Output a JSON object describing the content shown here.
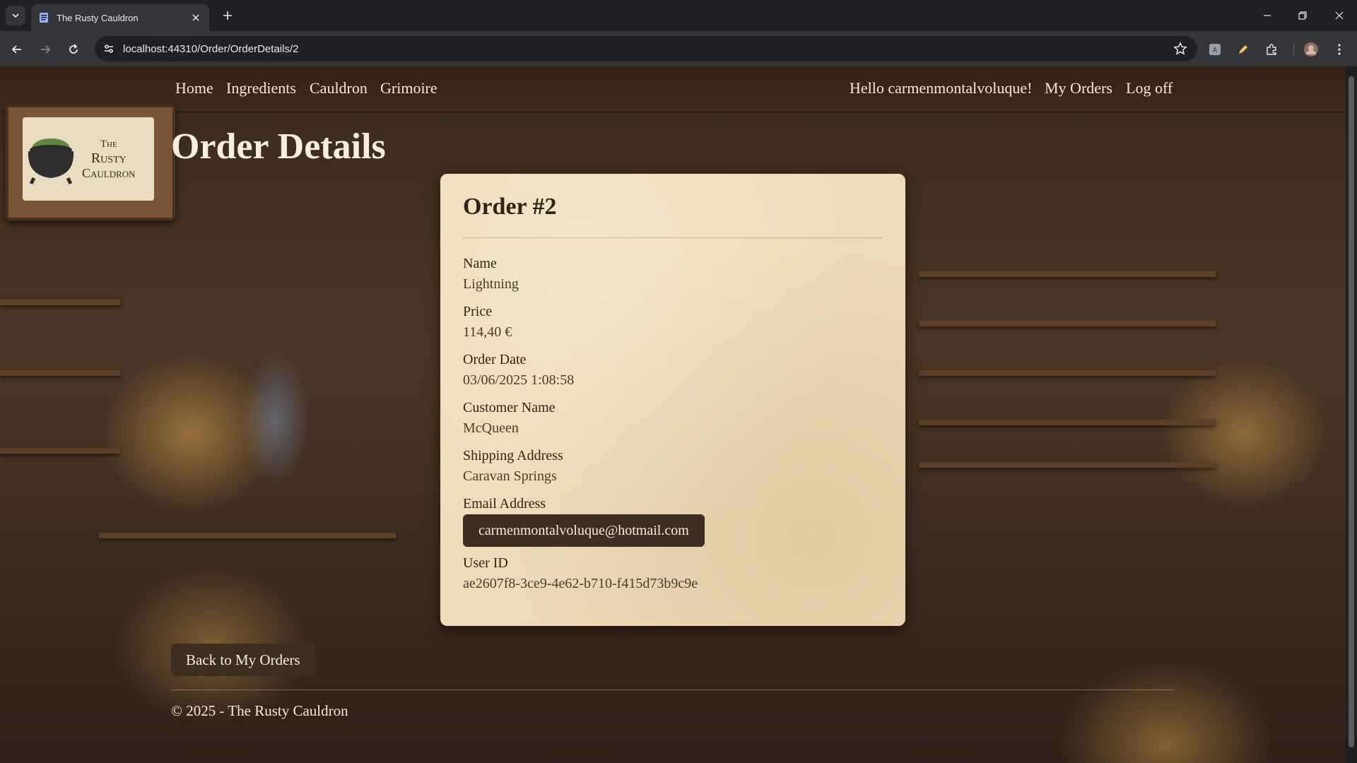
{
  "browser": {
    "tab_title": "The Rusty Cauldron",
    "url": "localhost:44310/Order/OrderDetails/2"
  },
  "nav": {
    "links": [
      "Home",
      "Ingredients",
      "Cauldron",
      "Grimoire"
    ],
    "greeting": "Hello carmenmontalvoluque!",
    "my_orders": "My Orders",
    "log_off": "Log off"
  },
  "logo": {
    "lines": [
      "The",
      "Rusty",
      "Cauldron"
    ]
  },
  "page": {
    "title": "Order Details"
  },
  "order": {
    "heading": "Order #2",
    "fields": [
      {
        "label": "Name",
        "value": "Lightning"
      },
      {
        "label": "Price",
        "value": "114,40 €"
      },
      {
        "label": "Order Date",
        "value": "03/06/2025 1:08:58"
      },
      {
        "label": "Customer Name",
        "value": "McQueen"
      },
      {
        "label": "Shipping Address",
        "value": "Caravan Springs"
      },
      {
        "label": "Email Address",
        "value": "carmenmontalvoluque@hotmail.com"
      },
      {
        "label": "User ID",
        "value": "ae2607f8-3ce9-4e62-b710-f415d73b9c9e"
      }
    ]
  },
  "actions": {
    "back": "Back to My Orders"
  },
  "footer": {
    "text": "© 2025 - The Rusty Cauldron"
  }
}
